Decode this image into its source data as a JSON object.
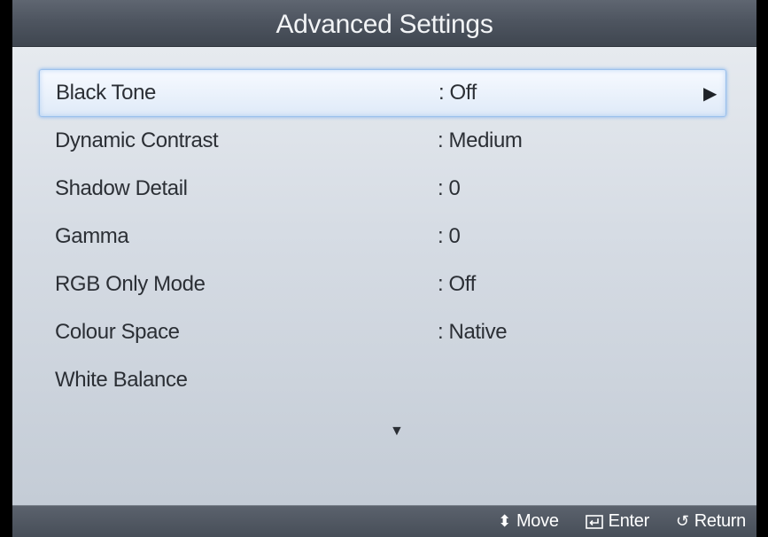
{
  "title": "Advanced Settings",
  "items": [
    {
      "label": "Black Tone",
      "value": ": Off",
      "selected": true
    },
    {
      "label": "Dynamic Contrast",
      "value": ": Medium"
    },
    {
      "label": "Shadow Detail",
      "value": ": 0"
    },
    {
      "label": "Gamma",
      "value": ": 0"
    },
    {
      "label": "RGB Only Mode",
      "value": ": Off"
    },
    {
      "label": "Colour Space",
      "value": ": Native"
    },
    {
      "label": "White Balance",
      "value": ""
    }
  ],
  "submenu_arrow": "▶",
  "scroll_indicator": "▼",
  "footer": {
    "move": {
      "icon": "up-down-arrows-icon",
      "label": "Move",
      "glyph": "⬍"
    },
    "enter": {
      "icon": "enter-icon",
      "label": "Enter"
    },
    "return": {
      "icon": "return-icon",
      "label": "Return",
      "glyph": "↺"
    }
  },
  "colors": {
    "selection_border": "#9cc1ec",
    "title_bar": "#4e5560",
    "panel": "#d6dce4"
  }
}
